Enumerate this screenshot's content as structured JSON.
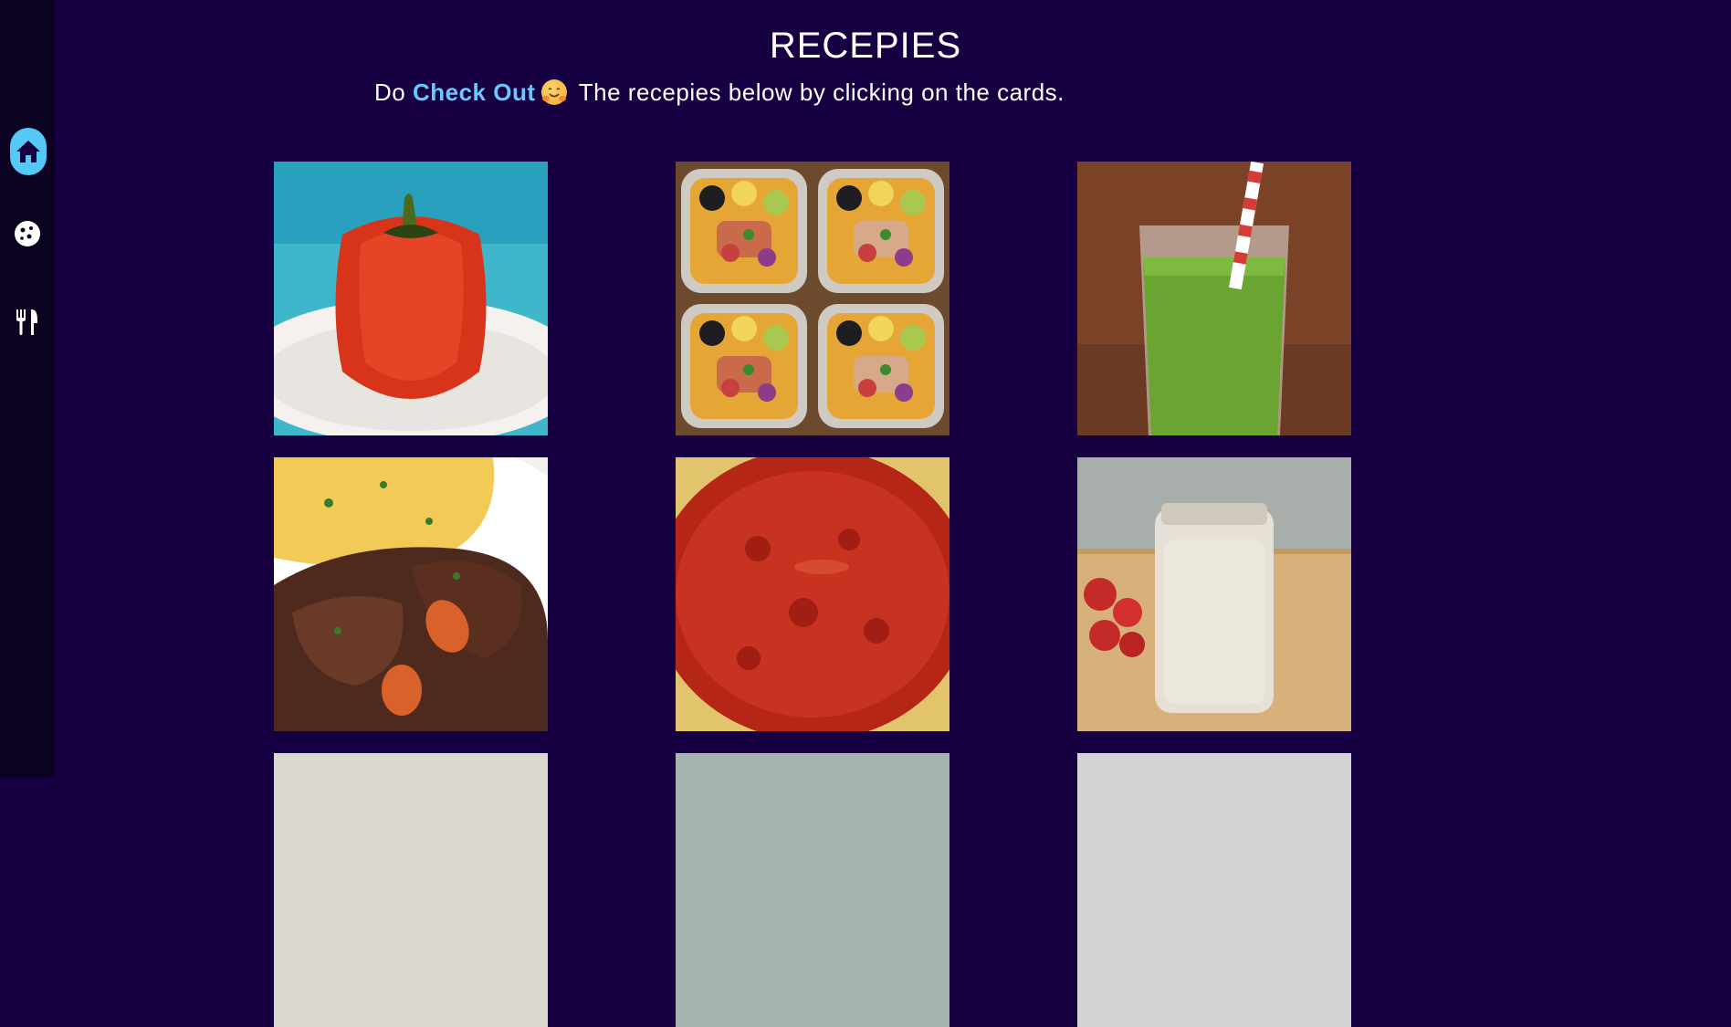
{
  "sidebar": {
    "items": [
      {
        "icon": "home-icon",
        "active": true
      },
      {
        "icon": "cookie-icon",
        "active": false
      },
      {
        "icon": "utensils-icon",
        "active": false
      }
    ],
    "accent": "#56c8f5"
  },
  "header": {
    "title": "RECEPIES",
    "subtitle_prefix": "Do ",
    "subtitle_highlight": "Check Out",
    "subtitle_suffix": " The recepies below by clicking on the cards."
  },
  "colors": {
    "background": "#170042",
    "sidebar": "#0b0120",
    "highlight": "#6cc6ff"
  },
  "cards": [
    {
      "name": "stuffed-pepper-card"
    },
    {
      "name": "meal-prep-bowls-card"
    },
    {
      "name": "green-smoothie-card"
    },
    {
      "name": "pot-roast-card"
    },
    {
      "name": "spaghetti-sauce-card"
    },
    {
      "name": "overnight-oats-card"
    },
    {
      "name": "recipe-card-7"
    },
    {
      "name": "recipe-card-8"
    },
    {
      "name": "recipe-card-9"
    }
  ]
}
